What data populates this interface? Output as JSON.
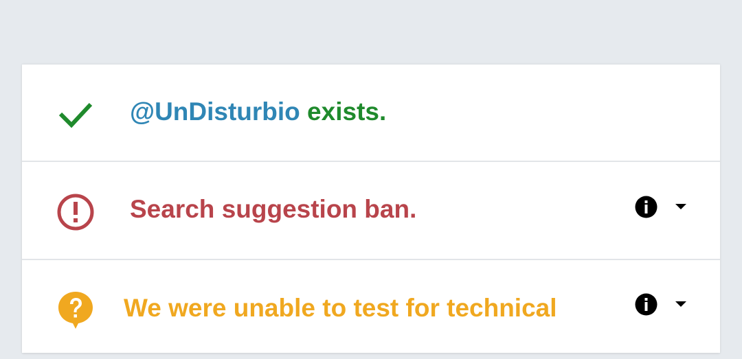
{
  "colors": {
    "background": "#e6eaee",
    "handle": "#2f86b5",
    "success": "#1f8a2c",
    "error": "#b8444b",
    "warning": "#f0a820"
  },
  "results": [
    {
      "status": "success",
      "icon": "check-icon",
      "handle": "@UnDisturbio",
      "message": " exists."
    },
    {
      "status": "error",
      "icon": "alert-circle-icon",
      "message": "Search suggestion ban.",
      "info_icon": "info-icon",
      "expand_icon": "caret-down-icon"
    },
    {
      "status": "warning",
      "icon": "question-bubble-icon",
      "message": "We were unable to test for technical",
      "info_icon": "info-icon",
      "expand_icon": "caret-down-icon"
    }
  ]
}
